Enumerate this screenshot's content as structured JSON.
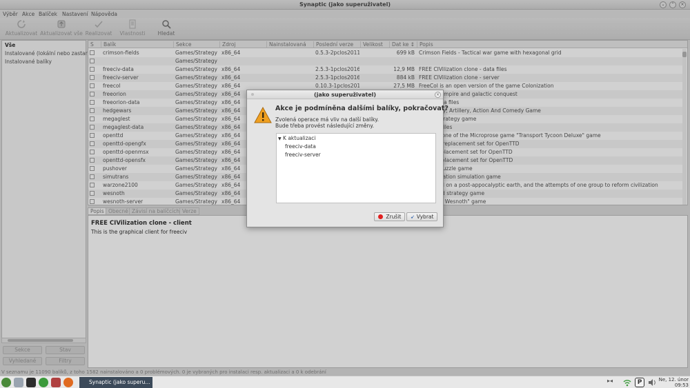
{
  "window": {
    "title": "Synaptic (jako superuživatel)"
  },
  "menu": [
    "Výběr",
    "Akce",
    "Balíček",
    "Nastavení",
    "Nápověda"
  ],
  "toolbar": {
    "reload": "Aktualizovat",
    "upgrade_all": "Aktualizovat vše",
    "apply": "Realizovat",
    "properties": "Vlastnosti",
    "search": "Hledat"
  },
  "sidebar": {
    "items": [
      "Vše",
      "Instalované (lokální nebo zastar",
      "Instalované balíky"
    ],
    "buttons": {
      "sections": "Sekce",
      "status": "Stav",
      "search_results": "Vyhledané",
      "filters": "Filtry"
    }
  },
  "table": {
    "columns": [
      "S",
      "Balík",
      "Sekce",
      "Zdroj",
      "Nainstalovaná",
      "Poslední verze",
      "Velikost",
      "Dat ke ↕",
      "Popis"
    ],
    "rows": [
      {
        "name": "crimson-fields",
        "section": "Games/Strategy",
        "source": "x86_64",
        "installed": "",
        "latest": "0.5.3-2pclos2011",
        "size": "",
        "download": "699 kB",
        "desc": "Crimson Fields - Tactical war game with hexagonal grid"
      },
      {
        "name": "",
        "section": "Games/Strategy",
        "source": "",
        "installed": "",
        "latest": "",
        "size": "",
        "download": "",
        "desc": ""
      },
      {
        "name": "freeciv-data",
        "section": "Games/Strategy",
        "source": "x86_64",
        "installed": "",
        "latest": "2.5.3-1pclos2016",
        "size": "",
        "download": "12,9 MB",
        "desc": "FREE CIVilization clone - data files"
      },
      {
        "name": "freeciv-server",
        "section": "Games/Strategy",
        "source": "x86_64",
        "installed": "",
        "latest": "2.5.3-1pclos2016",
        "size": "",
        "download": "884 kB",
        "desc": "FREE CIVilization clone - server"
      },
      {
        "name": "freecol",
        "section": "Games/Strategy",
        "source": "x86_64",
        "installed": "",
        "latest": "0.10.3-1pclos201",
        "size": "",
        "download": "27,5 MB",
        "desc": "FreeCol is an open version of the game Colonization"
      },
      {
        "name": "freeorion",
        "section": "Games/Strategy",
        "source": "x86_64",
        "installed": "",
        "latest": "",
        "size": "",
        "download": "",
        "desc": "d space empire and galactic conquest"
      },
      {
        "name": "freeorion-data",
        "section": "Games/Strategy",
        "source": "x86_64",
        "installed": "",
        "latest": "",
        "size": "",
        "download": "",
        "desc": "game data files"
      },
      {
        "name": "hedgewars",
        "section": "Games/Strategy",
        "source": "x86_64",
        "installed": "",
        "latest": "",
        "size": "",
        "download": "",
        "desc": "d Strategy, Artillery, Action And Comedy Game"
      },
      {
        "name": "megaglest",
        "section": "Games/Strategy",
        "source": "x86_64",
        "installed": "",
        "latest": "",
        "size": "",
        "download": "",
        "desc": "al time strategy game"
      },
      {
        "name": "megaglest-data",
        "section": "Games/Strategy",
        "source": "x86_64",
        "installed": "",
        "latest": "",
        "size": "",
        "download": "",
        "desc": "ast data files"
      },
      {
        "name": "openttd",
        "section": "Games/Strategy",
        "source": "x86_64",
        "installed": "",
        "latest": "",
        "size": "",
        "download": "",
        "desc": "source clone of the Microprose game \"Transport Tycoon Deluxe\" game"
      },
      {
        "name": "openttd-opengfx",
        "section": "Games/Strategy",
        "source": "x86_64",
        "installed": "",
        "latest": "",
        "size": "",
        "download": "",
        "desc": "graphics replacement set for OpenTTD"
      },
      {
        "name": "openttd-openmsx",
        "section": "Games/Strategy",
        "source": "x86_64",
        "installed": "",
        "latest": "",
        "size": "",
        "download": "",
        "desc": "music replacement set for OpenTTD"
      },
      {
        "name": "openttd-opensfx",
        "section": "Games/Strategy",
        "source": "x86_64",
        "installed": "",
        "latest": "",
        "size": "",
        "download": "",
        "desc": "sound replacement set for OpenTTD"
      },
      {
        "name": "pushover",
        "section": "Games/Strategy",
        "source": "x86_64",
        "installed": "",
        "latest": "",
        "size": "",
        "download": "",
        "desc": "is a fun puzzle game"
      },
      {
        "name": "simutrans",
        "section": "Games/Strategy",
        "source": "x86_64",
        "installed": "",
        "latest": "",
        "size": "",
        "download": "",
        "desc": "transportation simulation game"
      },
      {
        "name": "warzone2100",
        "section": "Games/Strategy",
        "source": "x86_64",
        "installed": "",
        "latest": "",
        "size": "",
        "download": "",
        "desc": "me based on a post-appocalyptic earth, and the attempts of one group to reform civilization"
      },
      {
        "name": "wesnoth",
        "section": "Games/Strategy",
        "source": "x86_64",
        "installed": "",
        "latest": "",
        "size": "",
        "download": "",
        "desc": "urn-based strategy game"
      },
      {
        "name": "wesnoth-server",
        "section": "Games/Strategy",
        "source": "x86_64",
        "installed": "",
        "latest": "",
        "size": "",
        "download": "",
        "desc": "\"Battle fo Wesnoth\" game"
      }
    ]
  },
  "details_tabs": [
    "Popis",
    "Obecné",
    "Závisí na balíčcích",
    "Verze"
  ],
  "details": {
    "heading": "FREE CIVilization clone - client",
    "body": "This is the graphical client for freeciv"
  },
  "statusbar": "V seznamu je 11090 balíků, z toho 1582 nainstalováno a 0 problémových. 0 je vybraných pro instalaci resp. aktualizaci a 0 k odebrání",
  "taskbar": {
    "task_label": "Synaptic (jako superu...",
    "clock_date": "Ne, 12. únor",
    "clock_time": "09:53"
  },
  "dialog": {
    "title": "(jako superuživatel)",
    "question": "Akce je podmíněna dalšími balíky, pokračovat?",
    "message_line1": "Zvolená operace má vliv na další balíky.",
    "message_line2": "Bude třeba provést následující změny.",
    "tree_group": "K aktualizaci",
    "tree_items": [
      "freeciv-data",
      "freeciv-server"
    ],
    "cancel": "Zrušit",
    "apply": "Vybrat"
  },
  "colors": {
    "warning": "#f0a020",
    "task_bg": "#3c4a5a",
    "cancel_dot": "#e02020"
  }
}
